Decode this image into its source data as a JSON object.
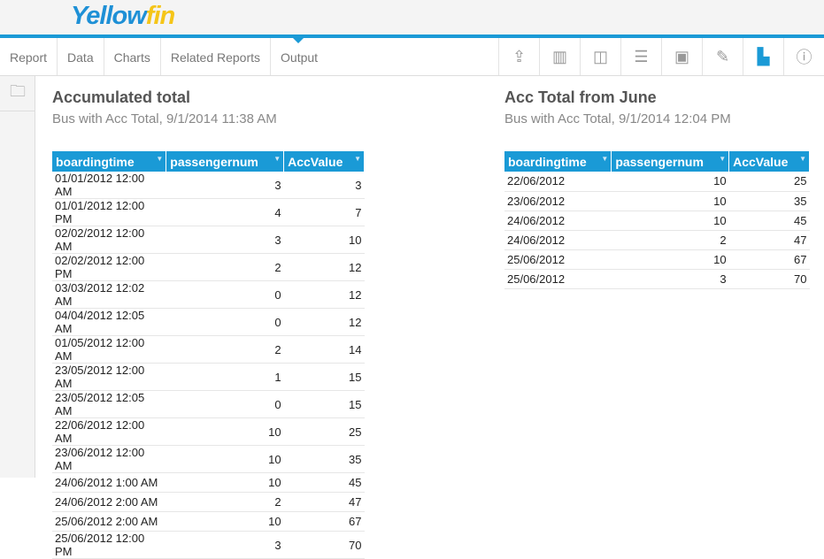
{
  "logo": {
    "text_a": "Y",
    "text_b": "ellow",
    "text_c": "fin"
  },
  "nav": {
    "tabs": [
      "Report",
      "Data",
      "Charts",
      "Related Reports",
      "Output"
    ],
    "active": "Output"
  },
  "tools": [
    "export-icon",
    "columns-icon",
    "column-highlight-icon",
    "checklist-icon",
    "filter-panel-icon",
    "edit-icon",
    "chart-icon",
    "info-icon"
  ],
  "reports": [
    {
      "title": "Accumulated total",
      "subtitle": "Bus with Acc Total, 9/1/2014 11:38 AM",
      "columns": [
        "boardingtime",
        "passengernum",
        "AccValue"
      ],
      "rows": [
        [
          "01/01/2012 12:00 AM",
          "3",
          "3"
        ],
        [
          "01/01/2012 12:00 PM",
          "4",
          "7"
        ],
        [
          "02/02/2012 12:00 AM",
          "3",
          "10"
        ],
        [
          "02/02/2012 12:00 PM",
          "2",
          "12"
        ],
        [
          "03/03/2012 12:02 AM",
          "0",
          "12"
        ],
        [
          "04/04/2012 12:05 AM",
          "0",
          "12"
        ],
        [
          "01/05/2012 12:00 AM",
          "2",
          "14"
        ],
        [
          "23/05/2012 12:00 AM",
          "1",
          "15"
        ],
        [
          "23/05/2012 12:05 AM",
          "0",
          "15"
        ],
        [
          "22/06/2012 12:00 AM",
          "10",
          "25"
        ],
        [
          "23/06/2012 12:00 AM",
          "10",
          "35"
        ],
        [
          "24/06/2012 1:00 AM",
          "10",
          "45"
        ],
        [
          "24/06/2012 2:00 AM",
          "2",
          "47"
        ],
        [
          "25/06/2012 2:00 AM",
          "10",
          "67"
        ],
        [
          "25/06/2012 12:00 PM",
          "3",
          "70"
        ]
      ]
    },
    {
      "title": "Acc Total from June",
      "subtitle": "Bus with Acc Total, 9/1/2014 12:04 PM",
      "columns": [
        "boardingtime",
        "passengernum",
        "AccValue"
      ],
      "rows": [
        [
          "22/06/2012",
          "10",
          "25"
        ],
        [
          "23/06/2012",
          "10",
          "35"
        ],
        [
          "24/06/2012",
          "10",
          "45"
        ],
        [
          "24/06/2012",
          "2",
          "47"
        ],
        [
          "25/06/2012",
          "10",
          "67"
        ],
        [
          "25/06/2012",
          "3",
          "70"
        ]
      ]
    }
  ]
}
